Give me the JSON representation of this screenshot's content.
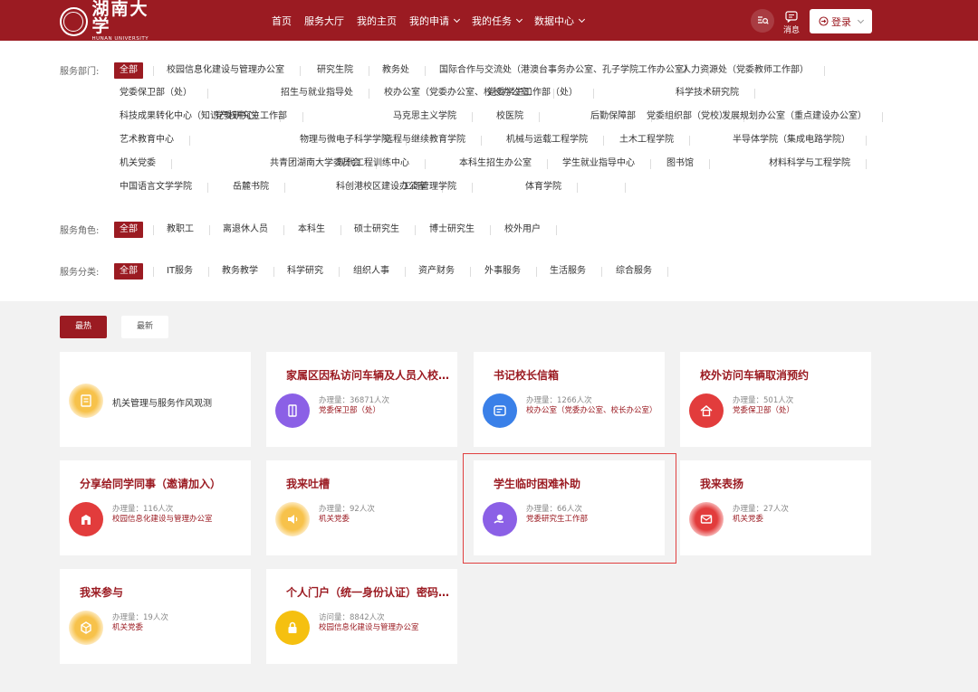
{
  "header": {
    "logo_cn": "湖南大学",
    "logo_en": "HUNAN UNIVERSITY",
    "nav": [
      {
        "label": "首页",
        "dropdown": false
      },
      {
        "label": "服务大厅",
        "dropdown": false
      },
      {
        "label": "我的主页",
        "dropdown": false
      },
      {
        "label": "我的申请",
        "dropdown": true
      },
      {
        "label": "我的任务",
        "dropdown": true
      },
      {
        "label": "数据中心",
        "dropdown": true
      }
    ],
    "message_label": "消息",
    "login_label": "登录"
  },
  "filters": {
    "departments": {
      "label": "服务部门:",
      "items": [
        "全部",
        "校园信息化建设与管理办公室",
        "研究生院",
        "教务处",
        "国际合作与交流处（港澳台事务办公室、孔子学院工作办公室）",
        "人力资源处（党委教师工作部）",
        "党委保卫部（处）",
        "招生与就业指导处",
        "校办公室（党委办公室、校长办公室）",
        "党委学生工作部（处）",
        "科学技术研究院",
        "科技成果转化中心（知识产权中心）",
        "党委研究生工作部",
        "马克思主义学院",
        "校医院",
        "后勤保障部",
        "党委组织部（党校）",
        "发展规划办公室（重点建设办公室）",
        "艺术教育中心",
        "物理与微电子科学学院",
        "远程与继续教育学院",
        "机械与运载工程学院",
        "土木工程学院",
        "半导体学院（集成电路学院）",
        "机关党委",
        "共青团湖南大学委员会",
        "现代工程训练中心",
        "本科生招生办公室",
        "学生就业指导中心",
        "图书馆",
        "材料科学与工程学院",
        "中国语言文学学院",
        "岳麓书院",
        "科创港校区建设办公室",
        "工商管理学院",
        "体育学院"
      ]
    },
    "roles": {
      "label": "服务角色:",
      "items": [
        "全部",
        "教职工",
        "离退休人员",
        "本科生",
        "硕士研究生",
        "博士研究生",
        "校外用户"
      ]
    },
    "categories": {
      "label": "服务分类:",
      "items": [
        "全部",
        "IT服务",
        "教务教学",
        "科学研究",
        "组织人事",
        "资产财务",
        "外事服务",
        "生活服务",
        "综合服务"
      ]
    }
  },
  "tabs": [
    "最热",
    "最新"
  ],
  "cards": [
    {
      "title": "机关管理与服务作风观测",
      "simple": true,
      "icon": "document-icon",
      "color": "yellow"
    },
    {
      "title": "家属区因私访问车辆及人员入校…",
      "count": "办理量：36871人次",
      "dept": "党委保卫部（处）",
      "icon": "door-icon",
      "color": "purple"
    },
    {
      "title": "书记校长信箱",
      "count": "办理量：1266人次",
      "dept": "校办公室（党委办公室、校长办公室）",
      "icon": "letter-icon",
      "color": "blue"
    },
    {
      "title": "校外访问车辆取消预约",
      "count": "办理量：501人次",
      "dept": "党委保卫部（处）",
      "icon": "home-icon",
      "color": "red"
    },
    {
      "title": "分享给同学同事（邀请加入）",
      "count": "办理量：116人次",
      "dept": "校园信息化建设与管理办公室",
      "icon": "building-icon",
      "color": "red"
    },
    {
      "title": "我来吐槽",
      "count": "办理量：92人次",
      "dept": "机关党委",
      "icon": "speaker-icon",
      "color": "yellow"
    },
    {
      "title": "学生临时困难补助",
      "count": "办理量：66人次",
      "dept": "党委研究生工作部",
      "icon": "hand-coin-icon",
      "color": "purple"
    },
    {
      "title": "我来表扬",
      "count": "办理量：27人次",
      "dept": "机关党委",
      "icon": "mail-icon",
      "color": "redglow"
    },
    {
      "title": "我来参与",
      "count": "办理量：19人次",
      "dept": "机关党委",
      "icon": "cube-icon",
      "color": "yellow"
    },
    {
      "title": "个人门户（统一身份认证）密码…",
      "count": "访问量：8842人次",
      "dept": "校园信息化建设与管理办公室",
      "icon": "lock-icon",
      "color": "gold"
    }
  ]
}
